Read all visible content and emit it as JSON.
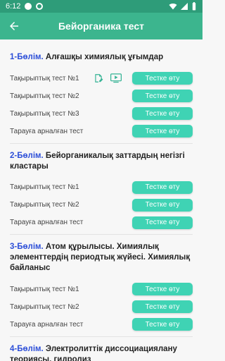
{
  "status": {
    "time": "6:12"
  },
  "header": {
    "title": "Бейорганика тест"
  },
  "sections": [
    {
      "num": "1-Бөлім.",
      "title": "Алғашқы химиялық ұғымдар",
      "rows": [
        {
          "label": "Тақырыптық тест №1",
          "button": "Тестке өту"
        },
        {
          "label": "Тақырыптық тест №2",
          "button": "Тестке өту"
        },
        {
          "label": "Тақырыптық тест №3",
          "button": "Тестке өту"
        },
        {
          "label": "Тарауға арналған тест",
          "button": "Тестке өту"
        }
      ]
    },
    {
      "num": "2-Бөлім.",
      "title": "Бейорганикалық заттардың негізгі кластары",
      "rows": [
        {
          "label": "Тақырыптық тест №1",
          "button": "Тестке өту"
        },
        {
          "label": "Тақырыптық тест №2",
          "button": "Тестке өту"
        },
        {
          "label": "Тарауға арналған тест",
          "button": "Тестке өту"
        }
      ]
    },
    {
      "num": "3-Бөлім.",
      "title": "Атом құрылысы. Химиялық элементтердің периодтық жүйесі. Химиялық байланыс",
      "rows": [
        {
          "label": "Тақырыптық тест №1",
          "button": "Тестке өту"
        },
        {
          "label": "Тақырыптық тест №2",
          "button": "Тестке өту"
        },
        {
          "label": "Тарауға арналған тест",
          "button": "Тестке өту"
        }
      ]
    },
    {
      "num": "4-Бөлім.",
      "title": "Электролиттік диссоциациялану теориясы, гидролиз",
      "rows": []
    }
  ],
  "colors": {
    "statusbar": "#2e9c79",
    "appbar": "#3cb58e",
    "button": "#3fd3b4",
    "section_number": "#2d4fd8"
  },
  "icons": {
    "row1": [
      "edit-note-icon",
      "video-play-icon"
    ]
  }
}
